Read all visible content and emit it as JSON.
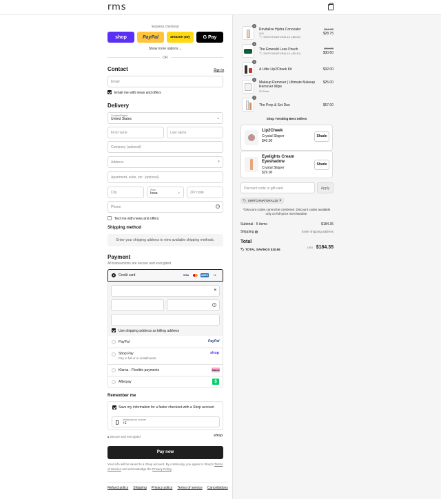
{
  "header": {
    "logo": "rms"
  },
  "express": {
    "title": "Express checkout",
    "shop": "shop",
    "paypal": "PayPal",
    "amazon": "amazon pay",
    "gpay": "G Pay",
    "more": "Show more options",
    "or": "OR"
  },
  "contact": {
    "title": "Contact",
    "signin": "Sign in",
    "email_ph": "Email",
    "news": "Email me with news and offers"
  },
  "delivery": {
    "title": "Delivery",
    "country_label": "Country/Region",
    "country": "United States",
    "first_ph": "First name",
    "last_ph": "Last name",
    "company_ph": "Company (optional)",
    "address_ph": "Address",
    "apt_ph": "Apartment, suite, etc. (optional)",
    "city_ph": "City",
    "state_label": "State",
    "state": "Iowa",
    "zip_ph": "ZIP code",
    "phone_ph": "Phone",
    "text_news": "Text me with news and offers"
  },
  "shipping": {
    "title": "Shipping method",
    "note": "Enter your shipping address to view available shipping methods."
  },
  "payment": {
    "title": "Payment",
    "sub": "All transactions are secure and encrypted.",
    "credit": "Credit card",
    "visa": "VISA",
    "amex": "AMEX",
    "plus": "+4",
    "billing": "Use shipping address as billing address",
    "paypal": "PayPal",
    "paypal_logo": "PayPal",
    "shoppay": "Shop Pay",
    "shoppay_sub": "Pay in full or in installments",
    "shoppay_logo": "shop",
    "klarna": "Klarna - Flexible payments",
    "klarna_logo": "Klarna",
    "afterpay": "Afterpay",
    "afterpay_logo": "$"
  },
  "remember": {
    "title": "Remember me",
    "save": "Save my information for a faster checkout with a Shop account",
    "phone_label": "Mobile phone number",
    "phone_val": "+1",
    "secure": "Secure and encrypted",
    "shop": "shop"
  },
  "paynow": "Pay now",
  "legal": {
    "text": "Your info will be saved to a Shop account. By continuing, you agree to Shop's",
    "tos": "Terms of Service",
    "and": "and acknowledge the",
    "privacy": "Privacy Policy"
  },
  "footer": {
    "links": [
      "Refund policy",
      "Shipping",
      "Privacy policy",
      "Terms of service",
      "Cancellations"
    ]
  },
  "cart": {
    "items": [
      {
        "name": "Revitalize Hydra Concealer",
        "sub": "000",
        "disc": "SWITCHNATURAL15 (-$5.25)",
        "old": "$34.00",
        "price": "$28.75",
        "qty": "1"
      },
      {
        "name": "The Emerald Luxe Pouch",
        "sub": "",
        "disc": "SWITCHNATURAL15 (-$5.40)",
        "old": "$36.00",
        "price": "$30.60",
        "qty": "1"
      },
      {
        "name": "A Little Lip2Cheek Kit",
        "sub": "",
        "disc": "",
        "old": "",
        "price": "$32.00",
        "qty": "1"
      },
      {
        "name": "Makeup Remover | Ultimate Makeup Remover Wipe",
        "sub": "20 Pack",
        "disc": "",
        "old": "",
        "price": "$25.00",
        "qty": "1"
      },
      {
        "name": "The Prep & Set Duo",
        "sub": "",
        "disc": "",
        "old": "",
        "price": "$67.00",
        "qty": "1"
      }
    ],
    "trending_title": "Shop Trending Best Sellers",
    "trending": [
      {
        "name": "Lip2Cheek",
        "variant": "Crystal Slipper",
        "price": "$40.00",
        "btn": "Shade"
      },
      {
        "name": "Eyelights Cream Eyeshadow",
        "variant": "Crystal Slipper",
        "price": "$29.00",
        "btn": "Shade"
      }
    ],
    "discount_ph": "Discount code or gift card",
    "apply": "Apply",
    "code": "SWITCHNATURAL15",
    "note": "*Discount codes cannot be combined. Discount codes available only on full-price merchandise.",
    "subtotal_label": "Subtotal · 5 items",
    "subtotal": "$184.35",
    "shipping_label": "Shipping",
    "shipping_val": "Enter shipping address",
    "total_label": "Total",
    "currency": "USD",
    "total": "$184.35",
    "savings_label": "TOTAL SAVINGS",
    "savings": "$10.65"
  }
}
